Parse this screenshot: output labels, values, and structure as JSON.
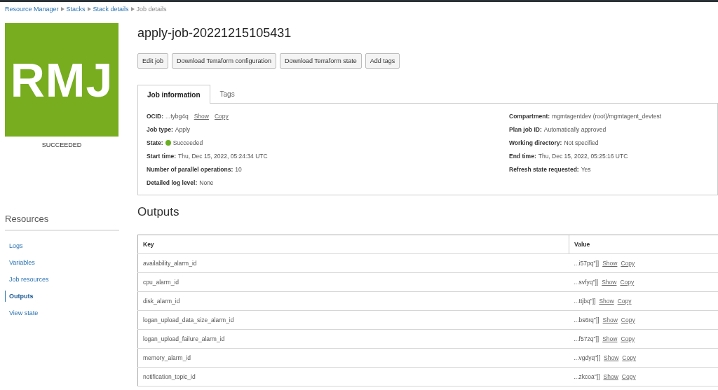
{
  "breadcrumb": [
    {
      "label": "Resource Manager",
      "link": true
    },
    {
      "label": "Stacks",
      "link": true
    },
    {
      "label": "Stack details",
      "link": true
    },
    {
      "label": "Job details",
      "link": false
    }
  ],
  "job": {
    "logo_text": "RMJ",
    "status": "SUCCEEDED",
    "title": "apply-job-20221215105431"
  },
  "actions": [
    "Edit job",
    "Download Terraform configuration",
    "Download Terraform state",
    "Add tags"
  ],
  "tabs": [
    {
      "label": "Job information",
      "selected": true
    },
    {
      "label": "Tags",
      "selected": false
    }
  ],
  "info_left": [
    {
      "kind": "id",
      "label": "OCID:",
      "value": "...tybg4q",
      "links": [
        "Show",
        "Copy"
      ]
    },
    {
      "kind": "text",
      "label": "Job type:",
      "value": "Apply"
    },
    {
      "kind": "state",
      "label": "State:",
      "value": "Succeeded",
      "color": "#6aaf23"
    },
    {
      "kind": "text",
      "label": "Start time:",
      "value": "Thu, Dec 15, 2022, 05:24:34 UTC"
    },
    {
      "kind": "text",
      "label": "Number of parallel operations:",
      "value": "10"
    },
    {
      "kind": "text",
      "label": "Detailed log level:",
      "value": "None"
    }
  ],
  "info_right": [
    {
      "kind": "text",
      "label": "Compartment:",
      "value": "mgmtagentdev (root)/mgmtagent_devtest"
    },
    {
      "kind": "text",
      "label": "Plan job ID:",
      "value": "Automatically approved"
    },
    {
      "kind": "text",
      "label": "Working directory:",
      "value": "Not specified"
    },
    {
      "kind": "text",
      "label": "End time:",
      "value": "Thu, Dec 15, 2022, 05:25:16 UTC"
    },
    {
      "kind": "text",
      "label": "Refresh state requested:",
      "value": "Yes"
    }
  ],
  "sidebar": {
    "title": "Resources",
    "items": [
      {
        "label": "Logs",
        "selected": false
      },
      {
        "label": "Variables",
        "selected": false
      },
      {
        "label": "Job resources",
        "selected": false
      },
      {
        "label": "Outputs",
        "selected": true
      },
      {
        "label": "View state",
        "selected": false
      }
    ]
  },
  "outputs": {
    "title": "Outputs",
    "columns": [
      "Key",
      "Value"
    ],
    "rows": [
      {
        "key": "availability_alarm_id",
        "value": "...i57pq\"]]",
        "links": [
          "Show",
          "Copy"
        ]
      },
      {
        "key": "cpu_alarm_id",
        "value": "...svfyq\"]]",
        "links": [
          "Show",
          "Copy"
        ]
      },
      {
        "key": "disk_alarm_id",
        "value": "...ttjbq\"]]",
        "links": [
          "Show",
          "Copy"
        ]
      },
      {
        "key": "logan_upload_data_size_alarm_id",
        "value": "...bs6rq\"]]",
        "links": [
          "Show",
          "Copy"
        ]
      },
      {
        "key": "logan_upload_failure_alarm_id",
        "value": "...f57zq\"]]",
        "links": [
          "Show",
          "Copy"
        ]
      },
      {
        "key": "memory_alarm_id",
        "value": "...vgdyq\"]]",
        "links": [
          "Show",
          "Copy"
        ]
      },
      {
        "key": "notification_topic_id",
        "value": "...zkcoa\"]]",
        "links": [
          "Show",
          "Copy"
        ]
      }
    ]
  }
}
